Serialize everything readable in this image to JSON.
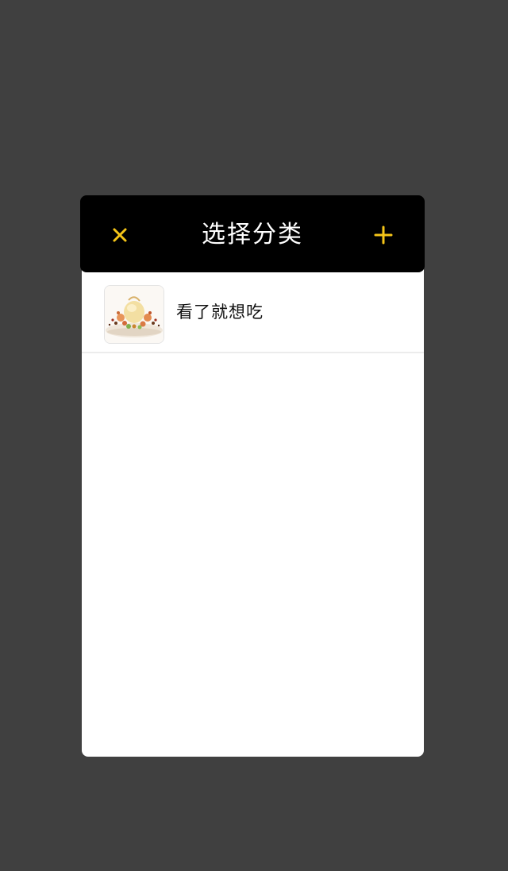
{
  "dialog": {
    "title": "选择分类",
    "close_icon": "close-icon",
    "add_icon": "plus-icon",
    "accent_color": "#f5c518"
  },
  "categories": [
    {
      "label": "看了就想吃",
      "thumbnail": "dessert-plate-image"
    }
  ]
}
